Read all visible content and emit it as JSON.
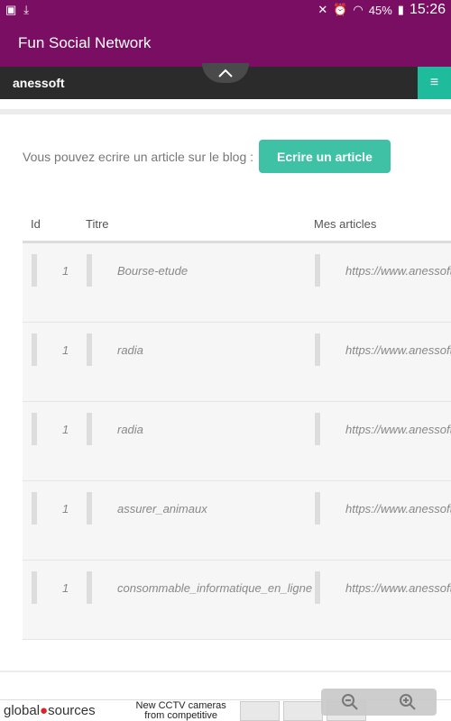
{
  "status": {
    "battery": "45%",
    "time": "15:26"
  },
  "app": {
    "title": "Fun Social Network"
  },
  "site": {
    "username": "anessoft",
    "menu_icon": "≡"
  },
  "cta": {
    "text": "Vous pouvez ecrire un article sur le blog :",
    "button": "Ecrire un article"
  },
  "table": {
    "headers": {
      "id": "Id",
      "title": "Titre",
      "articles": "Mes articles"
    },
    "rows": [
      {
        "id": "1",
        "title": "Bourse-etude",
        "link": "https://www.anessoft"
      },
      {
        "id": "1",
        "title": "radia",
        "link": "https://www.anessoft"
      },
      {
        "id": "1",
        "title": "radia",
        "link": "https://www.anessoft"
      },
      {
        "id": "1",
        "title": "assurer_animaux",
        "link": "https://www.anessoft"
      },
      {
        "id": "1",
        "title": "consommable_informatique_en_ligne",
        "link": "https://www.anessoft"
      }
    ]
  },
  "ad": {
    "brand_prefix": "global",
    "brand_suffix": "sources",
    "text": "New CCTV cameras from competitive"
  },
  "colors": {
    "appbar": "#7a0e63",
    "accent": "#3fc1a5",
    "sitebar": "#2b2b2b"
  }
}
